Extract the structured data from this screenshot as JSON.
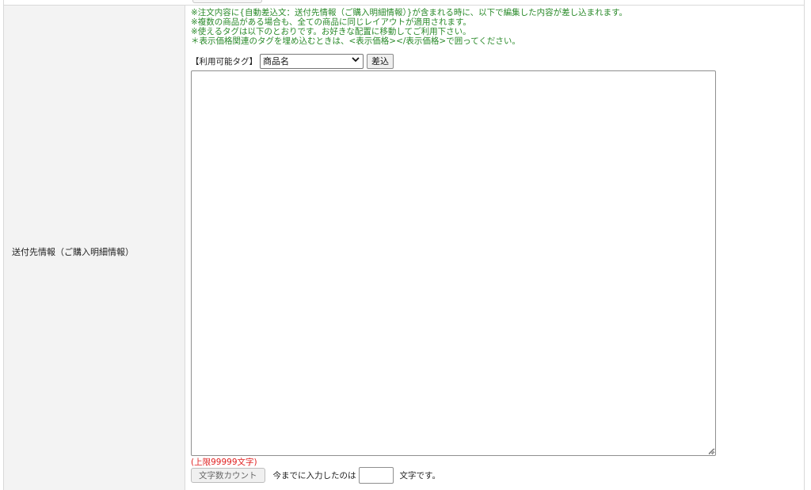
{
  "row": {
    "label": "送付先情報（ご購入明細情報）"
  },
  "notes": [
    "※注文内容に{自動差込文：送付先情報（ご購入明細情報）}が含まれる時に、以下で編集した内容が差し込まれます。",
    "※複数の商品がある場合も、全ての商品に同じレイアウトが適用されます。",
    "※使えるタグは以下のとおりです。お好きな配置に移動してご利用下さい。",
    "＊表示価格関連のタグを埋め込むときは、<表示価格></表示価格>で囲ってください。"
  ],
  "tag_selector": {
    "label": "【利用可能タグ】",
    "selected": "商品名",
    "insert_label": "差込"
  },
  "editor": {
    "value": ""
  },
  "limit_text": "(上限99999文字)",
  "counter": {
    "button_label": "文字数カウント",
    "prefix": "今までに入力したのは",
    "value": "",
    "suffix": "文字です。"
  },
  "colors": {
    "note_green": "#2a8a2a",
    "limit_red": "#e02020",
    "label_bg": "#f3f3f3"
  }
}
